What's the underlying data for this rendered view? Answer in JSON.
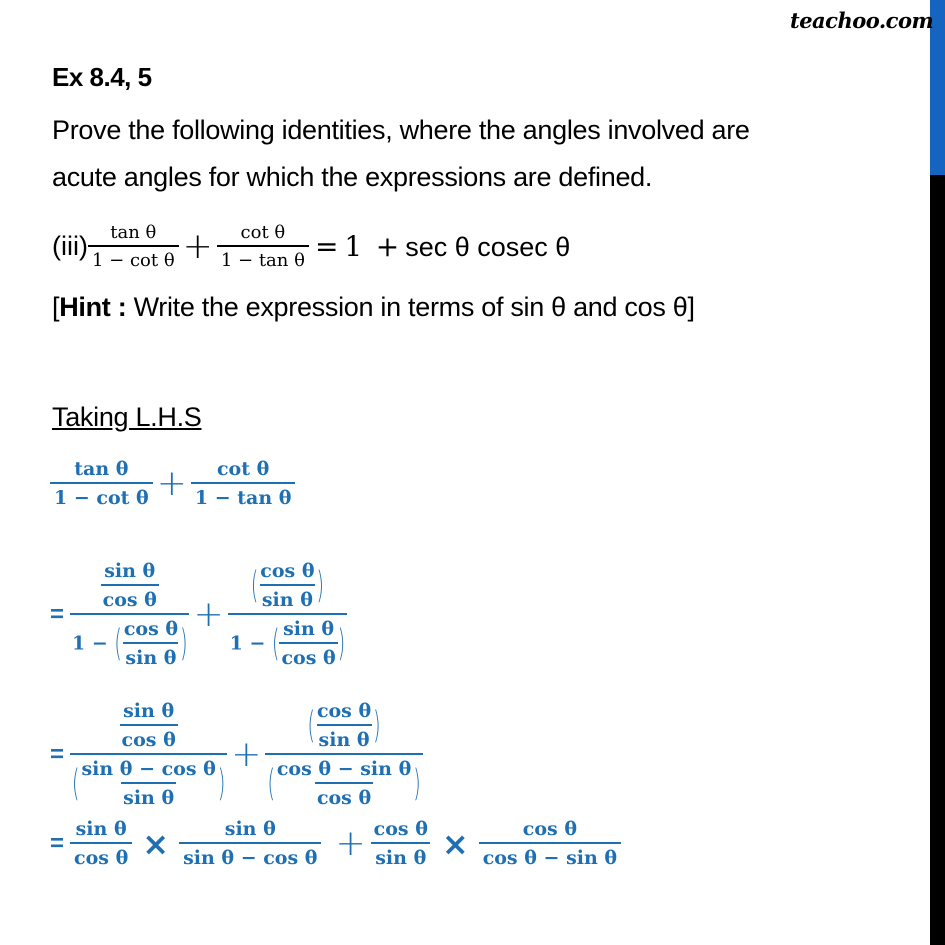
{
  "brand": {
    "text": "teachoo.com"
  },
  "colors": {
    "accent_blue": "#1f6fb3",
    "scrollbar_blue": "#1565c0",
    "scrollbar_track": "#000000"
  },
  "question": {
    "title": "Ex 8.4, 5",
    "line1": "Prove the following identities, where the angles involved are",
    "line2": "acute angles for which the expressions are defined.",
    "part_label": "(iii)",
    "identity": {
      "t1_num": "tan θ",
      "t1_den": "1 − cot θ",
      "plus": "+",
      "t2_num": "cot θ",
      "t2_den": "1 − tan θ",
      "equals": "=",
      "one": "1",
      "plus2": "+",
      "rhs": "sec θ cosec θ"
    },
    "hint_open": "[",
    "hint_bold": "Hint :",
    "hint_text": " Write the expression in terms of sin θ and cos θ]"
  },
  "solution": {
    "heading": "Taking L.H.S",
    "step1": {
      "t1_num": "tan θ",
      "t1_den": "1 − cot θ",
      "plus": "+",
      "t2_num": "cot θ",
      "t2_den": "1 − tan θ"
    },
    "step2": {
      "eq": "=",
      "a_num": "sin θ",
      "a_den": "cos θ",
      "a_den_one": "1 −",
      "a_den_inner_num": "cos θ",
      "a_den_inner_den": "sin θ",
      "plus": "+",
      "b_num": "cos θ",
      "b_den": "sin θ",
      "b_den_one": "1 −",
      "b_den_inner_num": "sin θ",
      "b_den_inner_den": "cos θ",
      "lp": "(",
      "rp": ")"
    },
    "step3": {
      "eq": "=",
      "a_num": "sin θ",
      "a_den": "cos θ",
      "a_den_inner_num": "sin θ − cos θ",
      "a_den_inner_den": "sin θ",
      "plus": "+",
      "b_num": "cos θ",
      "b_den": "sin θ",
      "b_den_inner_num": "cos θ − sin θ",
      "b_den_inner_den": "cos θ",
      "lp": "(",
      "rp": ")"
    },
    "step4": {
      "eq": "=",
      "f1_num": "sin θ",
      "f1_den": "cos θ",
      "times": "×",
      "f2_num": "sin θ",
      "f2_den": "sin θ − cos θ",
      "plus": "+",
      "f3_num": "cos θ",
      "f3_den": "sin θ",
      "f4_num": "cos θ",
      "f4_den": "cos θ − sin θ"
    }
  }
}
